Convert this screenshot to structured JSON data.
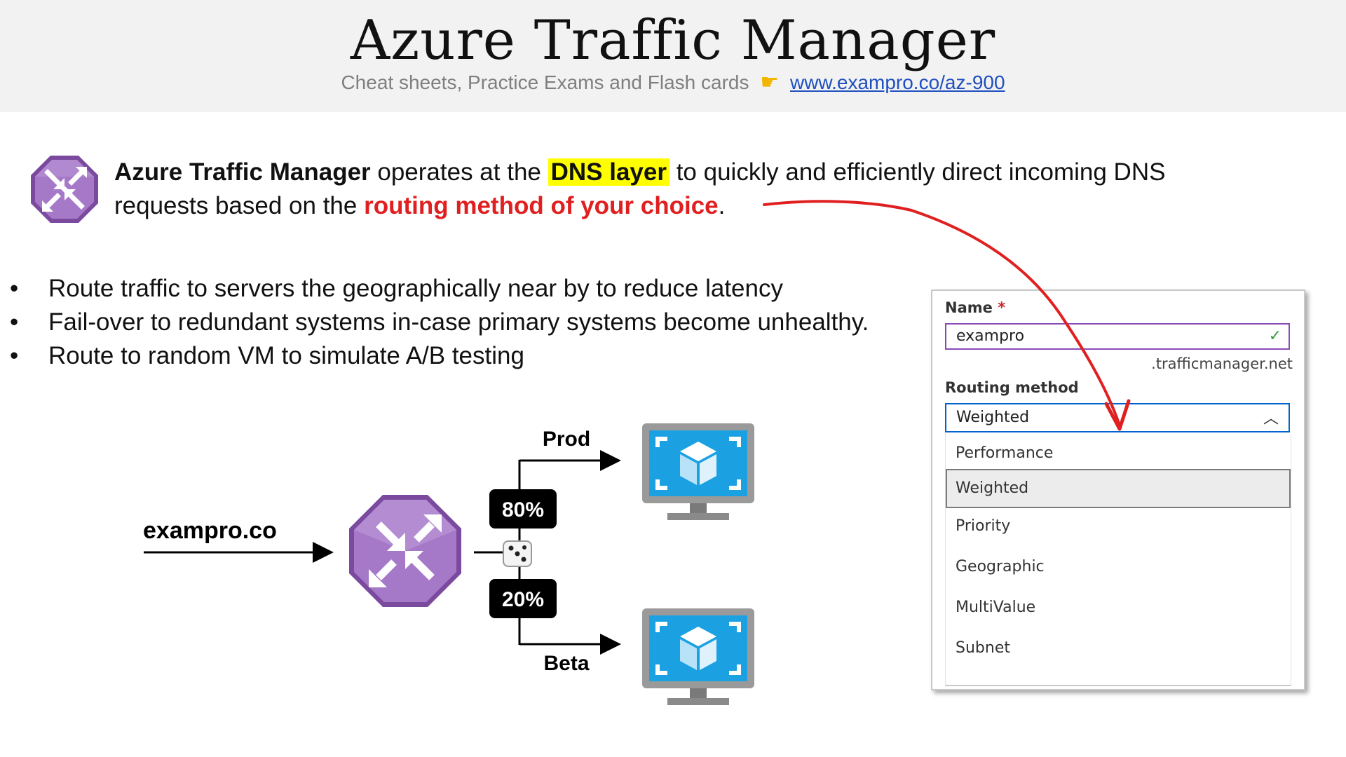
{
  "header": {
    "title": "Azure Traffic Manager",
    "subtitle": "Cheat sheets, Practice Exams and Flash cards",
    "pointer_icon": "pointing-hand-emoji",
    "link": "www.exampro.co/az-900"
  },
  "intro": {
    "part1_bold": "Azure Traffic Manager",
    "part2": " operates at the ",
    "highlight": "DNS layer",
    "part3": " to quickly and efficiently direct incoming DNS requests based on the ",
    "red": "routing method of your choice",
    "part4": "."
  },
  "bullets": [
    "Route traffic to servers the geographically near by to reduce latency",
    "Fail-over to redundant systems in-case primary systems become unhealthy.",
    "Route to random VM to simulate A/B testing"
  ],
  "diagram": {
    "source": "exampro.co",
    "top_label": "Prod",
    "top_pct": "80%",
    "bottom_label": "Beta",
    "bottom_pct": "20%"
  },
  "portal": {
    "name_label": "Name",
    "required_mark": "*",
    "name_value": "exampro",
    "suffix": ".trafficmanager.net",
    "routing_label": "Routing method",
    "routing_value": "Weighted",
    "options": [
      "Performance",
      "Weighted",
      "Priority",
      "Geographic",
      "MultiValue",
      "Subnet"
    ],
    "selected_option": "Weighted"
  },
  "colors": {
    "header_bg": "#f2f2f2",
    "link": "#1f4fbf",
    "highlight": "#ffff00",
    "red": "#e02020",
    "traffic_manager_purple": "#8f5bb5",
    "vm_blue": "#1ba1e2"
  }
}
